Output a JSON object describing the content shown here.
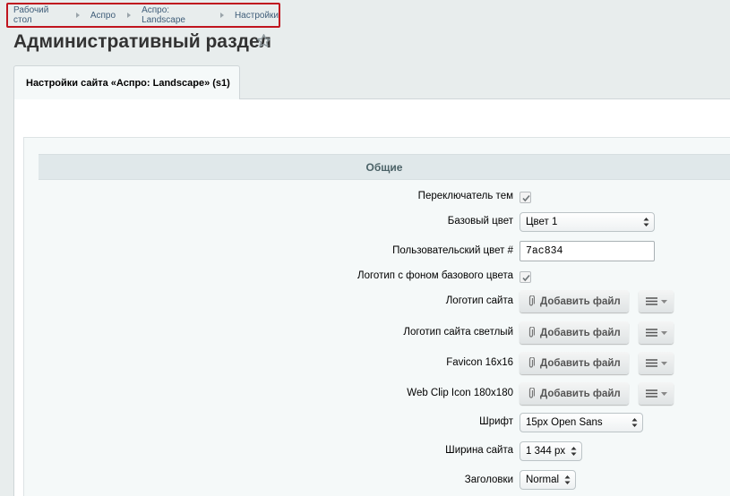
{
  "breadcrumb": [
    "Рабочий стол",
    "Аспро",
    "Аспро: Landscape",
    "Настройки"
  ],
  "page": {
    "title": "Административный раздел"
  },
  "tab": {
    "label": "Настройки сайта «Аспро: Landscape» (s1)"
  },
  "section": {
    "title": "Общие"
  },
  "form": {
    "theme_switcher_label": "Переключатель тем",
    "theme_switcher_checked": true,
    "base_color_label": "Базовый цвет",
    "base_color_value": "Цвет 1",
    "custom_color_label": "Пользовательский цвет #",
    "custom_color_value": "7ac834",
    "logo_bg_label": "Логотип с фоном базового цвета",
    "logo_bg_checked": true,
    "add_file_label": "Добавить файл",
    "file_rows": [
      {
        "label": "Логотип сайта"
      },
      {
        "label": "Логотип сайта светлый"
      },
      {
        "label": "Favicon 16x16"
      },
      {
        "label": "Web Clip Icon 180x180"
      }
    ],
    "font_label": "Шрифт",
    "font_value": "15px Open Sans",
    "width_label": "Ширина сайта",
    "width_value": "1 344 px",
    "headings_label": "Заголовки",
    "headings_value": "Normal"
  },
  "colors": {
    "highlight_border": "#c0151f",
    "section_header_bg": "#e0e8ea",
    "page_bg": "#e8eded"
  },
  "icons": [
    "star-icon",
    "checkmark-icon",
    "select-arrows-icon",
    "paperclip-icon",
    "menu-icon",
    "caret-down-icon"
  ]
}
